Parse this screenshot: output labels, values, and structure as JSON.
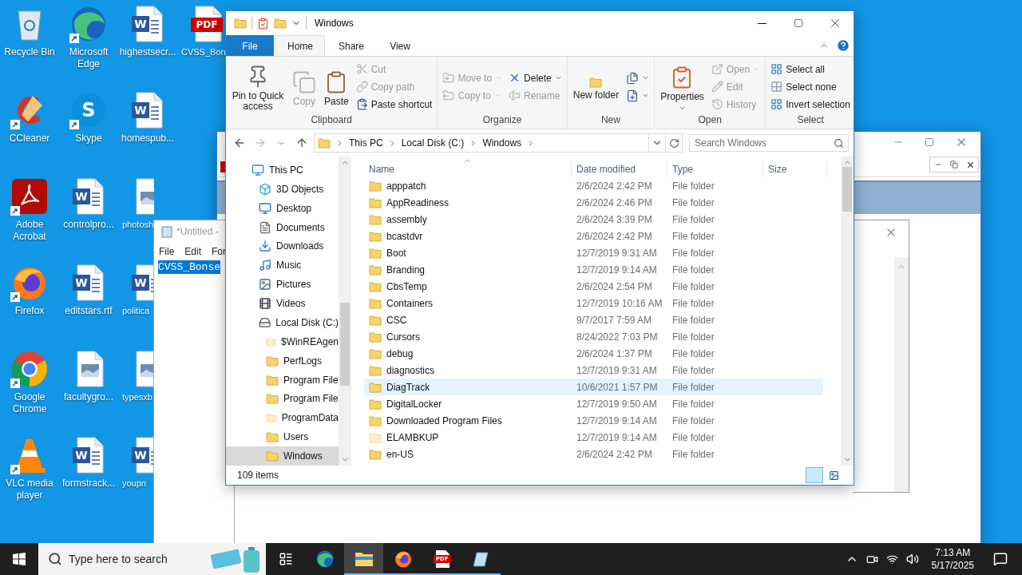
{
  "desktop_icons": [
    {
      "label": "Recycle Bin",
      "kind": "recycle",
      "shortcut": false
    },
    {
      "label": "CCleaner",
      "kind": "ccleaner",
      "shortcut": true
    },
    {
      "label": "Adobe Acrobat",
      "kind": "acrobat",
      "shortcut": true
    },
    {
      "label": "Firefox",
      "kind": "firefox",
      "shortcut": true
    },
    {
      "label": "Google Chrome",
      "kind": "chrome",
      "shortcut": true
    },
    {
      "label": "VLC media player",
      "kind": "vlc",
      "shortcut": true
    },
    {
      "label": "Microsoft Edge",
      "kind": "edge",
      "shortcut": true
    },
    {
      "label": "Skype",
      "kind": "skype",
      "shortcut": true,
      "badge": "S"
    },
    {
      "label": "controlpro...",
      "kind": "word",
      "shortcut": false,
      "badge": "W"
    },
    {
      "label": "editstars.rtf",
      "kind": "word",
      "shortcut": false,
      "badge": "W"
    },
    {
      "label": "facultygro...",
      "kind": "image",
      "shortcut": false
    },
    {
      "label": "formstrack...",
      "kind": "word",
      "shortcut": false,
      "badge": "W"
    },
    {
      "label": "highestsecr...",
      "kind": "word",
      "shortcut": false,
      "badge": "W"
    },
    {
      "label": "homespub...",
      "kind": "word",
      "shortcut": false,
      "badge": "W"
    },
    {
      "label": "photosh",
      "kind": "image",
      "shortcut": false
    },
    {
      "label": "politica",
      "kind": "word",
      "shortcut": false,
      "badge": "W"
    },
    {
      "label": "typesxb",
      "kind": "image",
      "shortcut": false
    },
    {
      "label": "youpn",
      "kind": "word",
      "shortcut": false,
      "badge": "W"
    },
    {
      "label": "CVSS_Bon",
      "kind": "pdf",
      "shortcut": false,
      "badge": "PDF"
    }
  ],
  "notepad": {
    "title": "*Untitled -",
    "menu": [
      "File",
      "Edit",
      "For"
    ],
    "selected_text": "CVSS_Bonse"
  },
  "explorer": {
    "title": "Windows",
    "ribbon_tabs": [
      {
        "label": "File",
        "kind": "file",
        "selected": false
      },
      {
        "label": "Home",
        "kind": "tab",
        "selected": true
      },
      {
        "label": "Share",
        "kind": "tab",
        "selected": false
      },
      {
        "label": "View",
        "kind": "tab",
        "selected": false
      }
    ],
    "ribbon_groups": [
      {
        "label": "Clipboard",
        "columns": [
          [
            {
              "kind": "large",
              "label": "Pin to Quick access",
              "disabled": false,
              "dropdown": false
            }
          ],
          [
            {
              "kind": "large",
              "label": "Copy",
              "disabled": true,
              "dropdown": false
            }
          ],
          [
            {
              "kind": "large",
              "label": "Paste",
              "disabled": false,
              "dropdown": false
            }
          ],
          [
            {
              "kind": "small",
              "label": "Cut",
              "disabled": true,
              "dropdown": false
            },
            {
              "kind": "small",
              "label": "Copy path",
              "disabled": true,
              "dropdown": false
            },
            {
              "kind": "small",
              "label": "Paste shortcut",
              "disabled": false,
              "dropdown": false
            }
          ]
        ]
      },
      {
        "label": "Organize",
        "columns": [
          [
            {
              "kind": "small",
              "label": "Move to",
              "disabled": true,
              "dropdown": true
            },
            {
              "kind": "small",
              "label": "Copy to",
              "disabled": true,
              "dropdown": true
            }
          ],
          [
            {
              "kind": "small",
              "label": "Delete",
              "disabled": false,
              "dropdown": true
            },
            {
              "kind": "small",
              "label": "Rename",
              "disabled": true,
              "dropdown": false
            }
          ]
        ]
      },
      {
        "label": "New",
        "columns": [
          [
            {
              "kind": "large",
              "label": "New folder",
              "disabled": false,
              "dropdown": false
            }
          ],
          [
            {
              "kind": "icon",
              "disabled": false,
              "dropdown": true
            },
            {
              "kind": "icon",
              "disabled": false,
              "dropdown": true
            }
          ]
        ]
      },
      {
        "label": "Open",
        "columns": [
          [
            {
              "kind": "large",
              "label": "Properties",
              "disabled": false,
              "dropdown": true
            }
          ],
          [
            {
              "kind": "small",
              "label": "Open",
              "disabled": true,
              "dropdown": true
            },
            {
              "kind": "small",
              "label": "Edit",
              "disabled": true,
              "dropdown": false
            },
            {
              "kind": "small",
              "label": "History",
              "disabled": true,
              "dropdown": false
            }
          ]
        ]
      },
      {
        "label": "Select",
        "columns": [
          [
            {
              "kind": "small",
              "label": "Select all",
              "disabled": false,
              "dropdown": false
            },
            {
              "kind": "small",
              "label": "Select none",
              "disabled": false,
              "dropdown": false
            },
            {
              "kind": "small",
              "label": "Invert selection",
              "disabled": false,
              "dropdown": false
            }
          ]
        ]
      }
    ],
    "nav_buttons": [
      {
        "kind": "back",
        "disabled": false
      },
      {
        "kind": "forward",
        "disabled": true
      },
      {
        "kind": "recent",
        "disabled": false
      },
      {
        "kind": "up",
        "disabled": false
      }
    ],
    "address": [
      "This PC",
      "Local Disk (C:)",
      "Windows"
    ],
    "search": {
      "placeholder": "Search Windows"
    },
    "nav_tree": [
      {
        "label": "This PC",
        "kind": "pc",
        "selected": false,
        "children": [
          {
            "label": "3D Objects",
            "kind": "objects",
            "selected": false
          },
          {
            "label": "Desktop",
            "kind": "desktop",
            "selected": false
          },
          {
            "label": "Documents",
            "kind": "documents",
            "selected": false
          },
          {
            "label": "Downloads",
            "kind": "downloads",
            "selected": false
          },
          {
            "label": "Music",
            "kind": "music",
            "selected": false
          },
          {
            "label": "Pictures",
            "kind": "pictures",
            "selected": false
          },
          {
            "label": "Videos",
            "kind": "videos",
            "selected": false
          },
          {
            "label": "Local Disk (C:)",
            "kind": "disk",
            "selected": false,
            "children": [
              {
                "label": "$WinREAgen",
                "kind": "folder",
                "hidden": true,
                "selected": false
              },
              {
                "label": "PerfLogs",
                "kind": "folder",
                "hidden": false,
                "selected": false
              },
              {
                "label": "Program File",
                "kind": "folder",
                "hidden": false,
                "selected": false
              },
              {
                "label": "Program File",
                "kind": "folder",
                "hidden": false,
                "selected": false
              },
              {
                "label": "ProgramData",
                "kind": "folder",
                "hidden": true,
                "selected": false
              },
              {
                "label": "Users",
                "kind": "folder",
                "hidden": false,
                "selected": false
              },
              {
                "label": "Windows",
                "kind": "folder",
                "hidden": false,
                "selected": true
              }
            ]
          }
        ]
      }
    ],
    "columns": [
      "Name",
      "Date modified",
      "Type",
      "Size"
    ],
    "rows": [
      {
        "name": "apppatch",
        "date": "2/6/2024 2:42 PM",
        "type": "File folder",
        "hidden": false,
        "selected": false
      },
      {
        "name": "AppReadiness",
        "date": "2/6/2024 2:46 PM",
        "type": "File folder",
        "hidden": false,
        "selected": false
      },
      {
        "name": "assembly",
        "date": "2/6/2024 3:39 PM",
        "type": "File folder",
        "hidden": false,
        "selected": false
      },
      {
        "name": "bcastdvr",
        "date": "2/6/2024 2:42 PM",
        "type": "File folder",
        "hidden": false,
        "selected": false
      },
      {
        "name": "Boot",
        "date": "12/7/2019 9:31 AM",
        "type": "File folder",
        "hidden": false,
        "selected": false
      },
      {
        "name": "Branding",
        "date": "12/7/2019 9:14 AM",
        "type": "File folder",
        "hidden": false,
        "selected": false
      },
      {
        "name": "CbsTemp",
        "date": "2/6/2024 2:54 PM",
        "type": "File folder",
        "hidden": false,
        "selected": false
      },
      {
        "name": "Containers",
        "date": "12/7/2019 10:16 AM",
        "type": "File folder",
        "hidden": false,
        "selected": false
      },
      {
        "name": "CSC",
        "date": "9/7/2017 7:59 AM",
        "type": "File folder",
        "hidden": false,
        "selected": false
      },
      {
        "name": "Cursors",
        "date": "8/24/2022 7:03 PM",
        "type": "File folder",
        "hidden": false,
        "selected": false
      },
      {
        "name": "debug",
        "date": "2/6/2024 1:37 PM",
        "type": "File folder",
        "hidden": false,
        "selected": false
      },
      {
        "name": "diagnostics",
        "date": "12/7/2019 9:31 AM",
        "type": "File folder",
        "hidden": false,
        "selected": false
      },
      {
        "name": "DiagTrack",
        "date": "10/6/2021 1:57 PM",
        "type": "File folder",
        "hidden": false,
        "selected": true
      },
      {
        "name": "DigitalLocker",
        "date": "12/7/2019 9:50 AM",
        "type": "File folder",
        "hidden": false,
        "selected": false
      },
      {
        "name": "Downloaded Program Files",
        "date": "12/7/2019 9:14 AM",
        "type": "File folder",
        "hidden": false,
        "selected": false
      },
      {
        "name": "ELAMBKUP",
        "date": "12/7/2019 9:14 AM",
        "type": "File folder",
        "hidden": true,
        "selected": false
      },
      {
        "name": "en-US",
        "date": "2/6/2024 2:42 PM",
        "type": "File folder",
        "hidden": false,
        "selected": false
      }
    ],
    "status": "109 items",
    "views": [
      {
        "kind": "details",
        "selected": true
      },
      {
        "kind": "thumbnails",
        "selected": false
      }
    ]
  },
  "taskbar": {
    "search_placeholder": "Type here to search",
    "apps": [
      {
        "kind": "taskview",
        "running": false,
        "active": false
      },
      {
        "kind": "edge",
        "running": false,
        "active": false
      },
      {
        "kind": "explorer",
        "running": true,
        "active": true
      },
      {
        "kind": "firefox",
        "running": true,
        "active": false
      },
      {
        "kind": "pdf",
        "running": true,
        "active": false,
        "badge": "PDF"
      },
      {
        "kind": "notepad",
        "running": true,
        "active": false
      }
    ],
    "time": "7:13 AM",
    "date": "5/17/2025"
  }
}
